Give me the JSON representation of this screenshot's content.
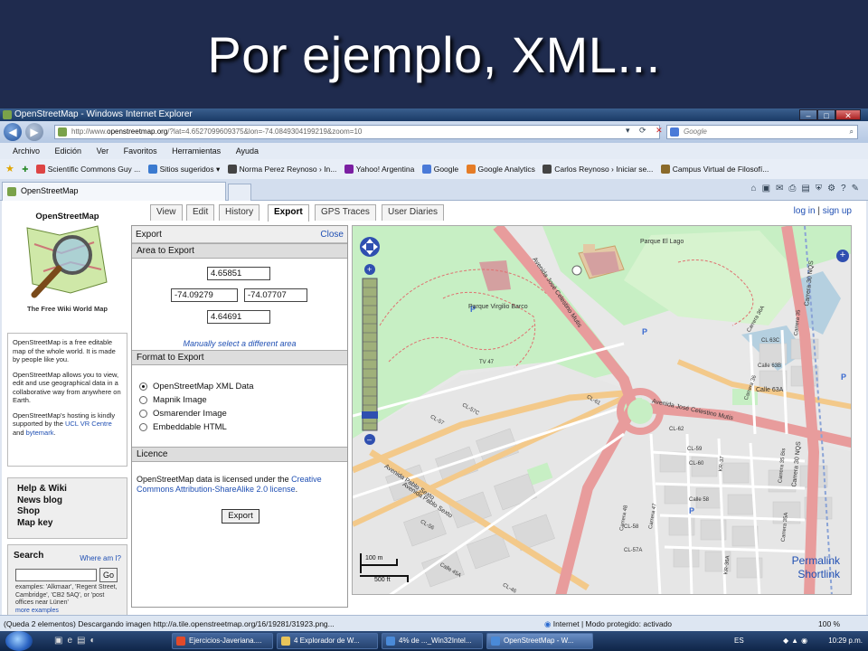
{
  "slide": {
    "title": "Por ejemplo, XML..."
  },
  "window": {
    "title": "OpenStreetMap - Windows Internet Explorer"
  },
  "address": {
    "url_prefix": "http://www.",
    "url_domain": "openstreetmap.org",
    "url_rest": "/?lat=4.6527099609375&lon=-74.0849304199219&zoom=10",
    "search_placeholder": "Google"
  },
  "menu": [
    "Archivo",
    "Edición",
    "Ver",
    "Favoritos",
    "Herramientas",
    "Ayuda"
  ],
  "favorites": [
    "Scientific Commons Guy ...",
    "Sitios sugeridos ▾",
    "Norma Perez Reynoso › In...",
    "Yahoo! Argentina",
    "Google",
    "Google Analytics",
    "Carlos Reynoso › Iniciar se...",
    "Campus Virtual de Filosofí..."
  ],
  "browser_tab": {
    "label": "OpenStreetMap"
  },
  "osm": {
    "logo_title": "OpenStreetMap",
    "logo_caption": "The Free Wiki World Map",
    "about": [
      "OpenStreetMap is a free editable map of the whole world. It is made by people like you.",
      "OpenStreetMap allows you to view, edit and use geographical data in a collaborative way from anywhere on Earth."
    ],
    "hosting_pre": "OpenStreetMap's hosting is kindly supported by the ",
    "hosting_link1": "UCL VR Centre",
    "hosting_mid": " and ",
    "hosting_link2": "bytemark",
    "hosting_end": ".",
    "help_links": [
      "Help & Wiki",
      "News blog",
      "Shop",
      "Map key"
    ],
    "search_title": "Search",
    "where_am_i": "Where am I?",
    "go": "Go",
    "search_examples": "examples: 'Alkmaar', 'Regent Street, Cambridge', 'CB2 5AQ', or 'post offices near Lünen'",
    "more_examples": "more examples",
    "tabs": [
      "View",
      "Edit",
      "History",
      "Export",
      "GPS Traces",
      "User Diaries"
    ],
    "active_tab": "Export",
    "login": "log in",
    "signup": "sign up",
    "export": {
      "header": "Export",
      "close": "Close",
      "area_title": "Area to Export",
      "north": "4.65851",
      "west": "-74.09279",
      "east": "-74.07707",
      "south": "4.64691",
      "manual_link": "Manually select a different area",
      "format_title": "Format to Export",
      "formats": [
        "OpenStreetMap XML Data",
        "Mapnik Image",
        "Osmarender Image",
        "Embeddable HTML"
      ],
      "selected_format": "OpenStreetMap XML Data",
      "licence_title": "Licence",
      "licence_text": "OpenStreetMap data is licensed under the ",
      "licence_link": "Creative Commons Attribution-ShareAlike 2.0 license",
      "licence_end": ".",
      "button": "Export"
    },
    "map": {
      "labels": {
        "parque_lago": "Parque El Lago",
        "parque_virgilio": "Parque Virgilio Barco",
        "avenida_celestino_1": "Avenida José Celestino Mutis",
        "avenida_celestino_2": "Avenida José Celestino Mutis",
        "avenida_pablo_1": "Avenida Pablo Sexto",
        "avenida_pablo_2": "Avenida Pablo Sexto",
        "carrera_30_1": "Carrera 30 NQS",
        "carrera_30_2": "Carrera 30 NQS",
        "calle_63a": "Calle 63A",
        "calle_63b": "Calle 63B",
        "calle_63c": "CL 63C",
        "tv47": "TV 47",
        "cl61": "CL-61",
        "cl62": "CL-62",
        "cl60": "CL-60",
        "cl59": "CL-59",
        "cl57": "CL-57",
        "cl57c": "CL-57C",
        "cl56": "CL-56",
        "cl57a": "CL-57A",
        "cl58": "CL-58",
        "cl45a": "Calle 45A",
        "cl46": "CL-46",
        "kr37": "KR-37",
        "kr36a": "KR-36A",
        "carrera_35": "Carrera 35",
        "carrera_36a": "Carrera 36A",
        "carrera_36": "Carrera 36",
        "carrera_35a": "Carrera 35A",
        "carrera_35b": "Carrera 35 Bis",
        "carrera_47": "Carrera 47",
        "carrera_48": "Carrera 48",
        "calle_58": "Calle 58"
      },
      "scale_m": "100 m",
      "scale_ft": "500 ft",
      "permalink": "Permalink",
      "shortlink": "Shortlink"
    }
  },
  "status": {
    "text": "(Queda 2 elementos) Descargando imagen http://a.tile.openstreetmap.org/16/19281/31923.png...",
    "zone": "Internet | Modo protegido: activado",
    "zoom": "100 %"
  },
  "taskbar": {
    "items": [
      "Ejercicios-Javeriana....",
      "4 Explorador de W...",
      "4% de ..._Win32Intel...",
      "OpenStreetMap - W..."
    ],
    "lang": "ES",
    "time": "10:29 p.m."
  },
  "colors": {
    "osm_link": "#1f4fb3",
    "slide_bg": "#1f2b4e",
    "road_primary": "#e89c9c",
    "road_secondary": "#f3c98a",
    "park": "#c7efc4"
  }
}
